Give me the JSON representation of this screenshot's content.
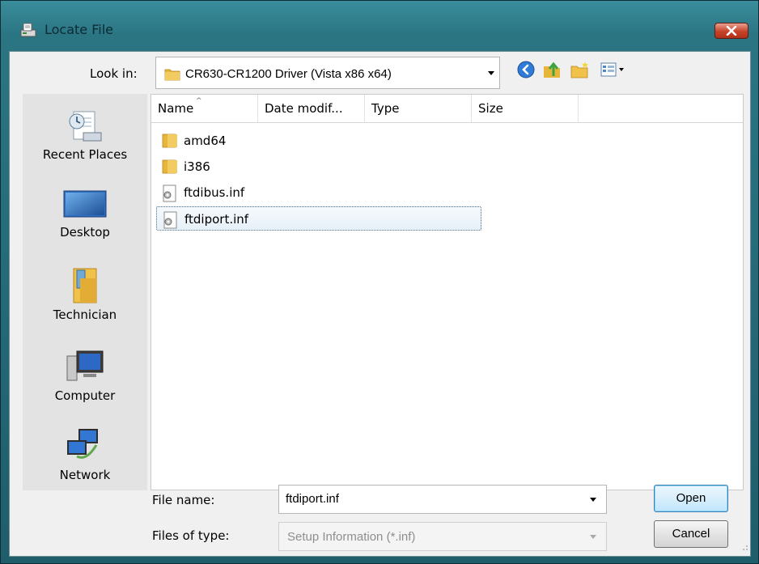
{
  "window": {
    "title": "Locate File",
    "close_icon": "close-icon"
  },
  "toolbar": {
    "look_in_label": "Look in:",
    "look_in_value": "CR630-CR1200 Driver (Vista x86 x64)",
    "icons": [
      "back-icon",
      "up-folder-icon",
      "new-folder-icon",
      "views-menu-icon"
    ]
  },
  "places": [
    {
      "label": "Recent Places",
      "icon": "recent-places-icon"
    },
    {
      "label": "Desktop",
      "icon": "desktop-icon"
    },
    {
      "label": "Technician",
      "icon": "user-folder-icon"
    },
    {
      "label": "Computer",
      "icon": "computer-icon"
    },
    {
      "label": "Network",
      "icon": "network-icon"
    }
  ],
  "columns": [
    "Name",
    "Date modif...",
    "Type",
    "Size"
  ],
  "files": [
    {
      "name": "amd64",
      "kind": "folder"
    },
    {
      "name": "i386",
      "kind": "folder"
    },
    {
      "name": "ftdibus.inf",
      "kind": "inf"
    },
    {
      "name": "ftdiport.inf",
      "kind": "inf",
      "selected": true
    }
  ],
  "bottom": {
    "file_name_label": "File name:",
    "file_name_value": "ftdiport.inf",
    "files_of_type_label": "Files of type:",
    "files_of_type_value": "Setup Information (*.inf)",
    "open_label": "Open",
    "cancel_label": "Cancel"
  },
  "colors": {
    "accent": "#3c7fb1",
    "titlebar": "#2b7583",
    "folder": "#e8b53b",
    "close": "#c6432a"
  }
}
